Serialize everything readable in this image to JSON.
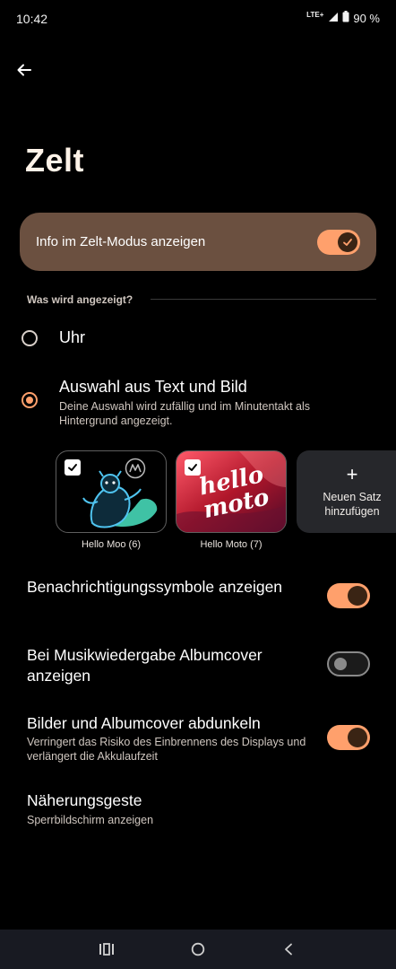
{
  "status": {
    "time": "10:42",
    "network": "LTE+",
    "battery": "90 %"
  },
  "page": {
    "title": "Zelt"
  },
  "master": {
    "label": "Info im Zelt-Modus anzeigen",
    "enabled": true
  },
  "section": {
    "header": "Was wird angezeigt?"
  },
  "options": [
    {
      "title": "Uhr",
      "selected": false
    },
    {
      "title": "Auswahl aus Text und Bild",
      "subtitle": "Deine Auswahl wird zufällig und im Minutentakt als Hintergrund angezeigt.",
      "selected": true
    }
  ],
  "sets": [
    {
      "caption": "Hello Moo (6)",
      "checked": true
    },
    {
      "caption": "Hello Moto (7)",
      "checked": true,
      "art_text": "hello moto"
    }
  ],
  "add_set": {
    "label": "Neuen Satz hinzufügen"
  },
  "settings": [
    {
      "title": "Benachrichtigungssymbole anzeigen",
      "on": true
    },
    {
      "title": "Bei Musikwiedergabe Albumcover anzeigen",
      "on": false
    },
    {
      "title": "Bilder und Albumcover abdunkeln",
      "subtitle": "Verringert das Risiko des Einbrennens des Displays und verlängert die Akkulaufzeit",
      "on": true
    },
    {
      "title": "Näherungsgeste",
      "subtitle": "Sperrbildschirm anzeigen"
    }
  ],
  "colors": {
    "accent": "#ffa06c",
    "card": "#6b5040",
    "background": "#000000"
  }
}
